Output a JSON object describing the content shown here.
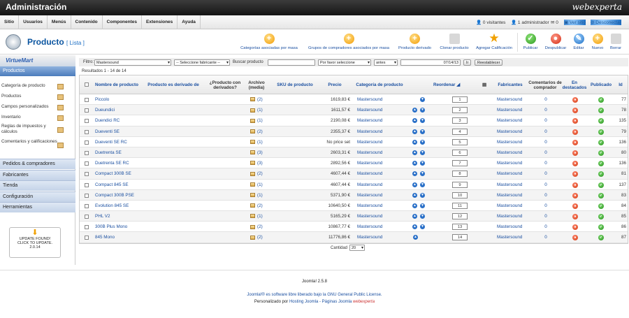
{
  "header": {
    "title": "Administración",
    "brand": "webexperta"
  },
  "menu": {
    "items": [
      "Sitio",
      "Usuarios",
      "Menús",
      "Contenido",
      "Componentes",
      "Extensiones",
      "Ayuda"
    ],
    "visitors": "0 visitantes",
    "admins": "1 administrador",
    "messages": "0",
    "view_site": "Ver sitio",
    "logout": "Desconectar"
  },
  "toolbar": {
    "page_title": "Producto",
    "page_subtitle": "[ Lista ]",
    "buttons": {
      "cat_mass": "Categorías asociadas por masa",
      "group_mass": "Grupos de compradores asociados por masa",
      "derived": "Producto derivado",
      "clone": "Clonar producto",
      "rating": "Agregar Calificación",
      "publish": "Publicar",
      "unpublish": "Despublicar",
      "edit": "Editar",
      "new": "Nuevo",
      "delete": "Borrar"
    }
  },
  "sidebar": {
    "logo": "VirtueMart",
    "active": "Productos",
    "items": [
      "Categoría de producto",
      "Productos",
      "Campos personalizados",
      "Inventario",
      "Reglas de impuestos y cálculos",
      "Comentarios y calificaciones"
    ],
    "sections": [
      "Pedidos & compradores",
      "Fabricantes",
      "Tienda",
      "Configuración",
      "Herramientas"
    ],
    "update_line1": "UPDATE FOUND!",
    "update_line2": "CLICK TO UPDATE.",
    "update_version": "2.0.14"
  },
  "filter": {
    "label": "Filtro:",
    "value": "Mastersound",
    "manufacturer": "-- Seleccione fabricante --",
    "search_label": "Buscar producto",
    "search_value": "",
    "please_select": "Por favor seleccione",
    "before": "antes",
    "date": "07/14/13",
    "go": "Ir",
    "reset": "Reestablecer"
  },
  "results": "Resultados 1 - 14 de 14",
  "columns": {
    "name": "Nombre de producto",
    "derived_of": "Producto es derivado de",
    "has_derived": "¿Producto con derivados?",
    "media": "Archivo (media)",
    "sku": "SKU de producto",
    "price": "Precio",
    "category": "Categoría de producto",
    "reorder": "Reordenar",
    "manufacturer": "Fabricantes",
    "reviews": "Comentarios de comprador",
    "featured": "En destacados",
    "published": "Publicado",
    "id": "Id"
  },
  "rows": [
    {
      "name": "Piccolo",
      "media": "(2)",
      "price": "1619,83 €",
      "category": "Mastersound",
      "order": "1",
      "manufacturer": "Mastersound",
      "reviews": "0",
      "id": "77",
      "arrows": "d"
    },
    {
      "name": "Dueundici",
      "media": "(1)",
      "price": "1611,57 €",
      "category": "Mastersound",
      "order": "2",
      "manufacturer": "Mastersound",
      "reviews": "0",
      "id": "78",
      "arrows": "ud"
    },
    {
      "name": "Duendici RC",
      "media": "(1)",
      "price": "2190,08 €",
      "category": "Mastersound",
      "order": "3",
      "manufacturer": "Mastersound",
      "reviews": "0",
      "id": "135",
      "arrows": "ud"
    },
    {
      "name": "Dueventi SE",
      "media": "(2)",
      "price": "2355,37 €",
      "category": "Mastersound",
      "order": "4",
      "manufacturer": "Mastersound",
      "reviews": "0",
      "id": "79",
      "arrows": "ud"
    },
    {
      "name": "Dueventi SE RC",
      "media": "(1)",
      "price": "No price set",
      "category": "Mastersound",
      "order": "5",
      "manufacturer": "Mastersound",
      "reviews": "0",
      "id": "136",
      "arrows": "ud"
    },
    {
      "name": "Duetrenta SE",
      "media": "(3)",
      "price": "2603,31 €",
      "category": "Mastersound",
      "order": "6",
      "manufacturer": "Mastersound",
      "reviews": "0",
      "id": "80",
      "arrows": "ud"
    },
    {
      "name": "Duetrenta SE RC",
      "media": "(3)",
      "price": "2892,56 €",
      "category": "Mastersound",
      "order": "7",
      "manufacturer": "Mastersound",
      "reviews": "0",
      "id": "136",
      "arrows": "ud"
    },
    {
      "name": "Compact 300B SE",
      "media": "(2)",
      "price": "4607,44 €",
      "category": "Mastersound",
      "order": "8",
      "manufacturer": "Mastersound",
      "reviews": "0",
      "id": "81",
      "arrows": "ud"
    },
    {
      "name": "Compact 845 SE",
      "media": "(1)",
      "price": "4607,44 €",
      "category": "Mastersound",
      "order": "9",
      "manufacturer": "Mastersound",
      "reviews": "0",
      "id": "137",
      "arrows": "ud"
    },
    {
      "name": "Compact 300B PSE",
      "media": "(1)",
      "price": "5371,90 €",
      "category": "Mastersound",
      "order": "10",
      "manufacturer": "Mastersound",
      "reviews": "0",
      "id": "83",
      "arrows": "ud"
    },
    {
      "name": "Evolution 845 SE",
      "media": "(2)",
      "price": "10640,50 €",
      "category": "Mastersound",
      "order": "11",
      "manufacturer": "Mastersound",
      "reviews": "0",
      "id": "84",
      "arrows": "ud"
    },
    {
      "name": "PHL V2",
      "media": "(1)",
      "price": "5165,29 €",
      "category": "Mastersound",
      "order": "12",
      "manufacturer": "Mastersound",
      "reviews": "0",
      "id": "85",
      "arrows": "ud"
    },
    {
      "name": "300B Plus Mono",
      "media": "(2)",
      "price": "10867,77 €",
      "category": "Mastersound",
      "order": "13",
      "manufacturer": "Mastersound",
      "reviews": "0",
      "id": "86",
      "arrows": "ud"
    },
    {
      "name": "845 Mono",
      "media": "(2)",
      "price": "11776,86 €",
      "category": "Mastersound",
      "order": "14",
      "manufacturer": "Mastersound",
      "reviews": "0",
      "id": "87",
      "arrows": "u"
    }
  ],
  "pagination": {
    "label": "Cantidad",
    "value": "20"
  },
  "footer": {
    "version": "Joomla! 2.5.8",
    "license_prefix": "Joomla!® es software libre liberado bajo la",
    "license_link": "GNU General Public License.",
    "custom_prefix": "Personalizado por",
    "custom_link": "Hosting Joomla - Páginas Joomla",
    "custom_brand": "webexperta"
  }
}
